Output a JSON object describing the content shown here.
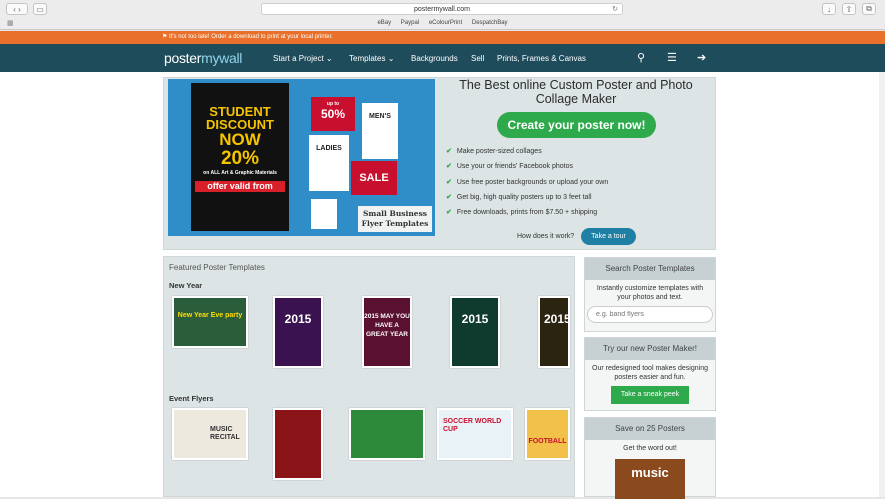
{
  "browser": {
    "url": "postermywall.com",
    "bookmarks": [
      "eBay",
      "Paypal",
      "eColourPrint",
      "DespatchBay"
    ]
  },
  "banner": {
    "text": "It's not too late! Order a download to print at your local printer."
  },
  "nav": {
    "logo_a": "poster",
    "logo_b": "mywall",
    "links": [
      "Start a Project",
      "Templates",
      "Backgrounds",
      "Sell",
      "Prints, Frames & Canvas"
    ]
  },
  "hero": {
    "title": "The Best online Custom Poster and Photo Collage Maker",
    "cta": "Create your poster now!",
    "features": [
      "Make poster-sized collages",
      "Use your or friends' Facebook photos",
      "Use free poster backgrounds or upload your own",
      "Get big, high quality posters up to 3 feet tall",
      "Free downloads, prints from $7.50 + shipping"
    ],
    "how_label": "How does it work?",
    "tour_button": "Take a tour",
    "image": {
      "l1": "STUDENT",
      "l2": "DISCOUNT",
      "l3": "NOW",
      "l4": "20%",
      "l5": "on ALL Art & Graphic Materials",
      "l6": "offer valid from",
      "tag1": "up to",
      "tag1b": "50%",
      "tag2": "MEN'S",
      "tag3": "LADIES",
      "tag4": "SALE",
      "caption1": "Small Business",
      "caption2": "Flyer Templates"
    }
  },
  "featured": {
    "header": "Featured Poster Templates",
    "sections": [
      "New Year",
      "Event Flyers"
    ],
    "thumbs_newyear": [
      "New Year Eve party",
      "2015",
      "2015 MAY YOU HAVE A GREAT YEAR",
      "2015",
      "2015"
    ],
    "thumbs_event": [
      "MUSIC RECITAL",
      "",
      "",
      "SOCCER WORLD CUP",
      "FOOTBALL"
    ]
  },
  "sidebar": {
    "search_header": "Search Poster Templates",
    "search_text": "Instantly customize templates with your photos and text.",
    "search_placeholder": "e.g. band flyers",
    "maker_header": "Try our new Poster Maker!",
    "maker_text": "Our redesigned tool makes designing posters easier and fun.",
    "maker_button": "Take a sneak peek",
    "save_header": "Save on 25 Posters",
    "save_text": "Get the word out!",
    "save_img_text": "music"
  },
  "colors": {
    "nav": "#1f4c5b",
    "banner": "#e8702a",
    "green": "#2eaa4c",
    "blue": "#1f7fa5"
  }
}
